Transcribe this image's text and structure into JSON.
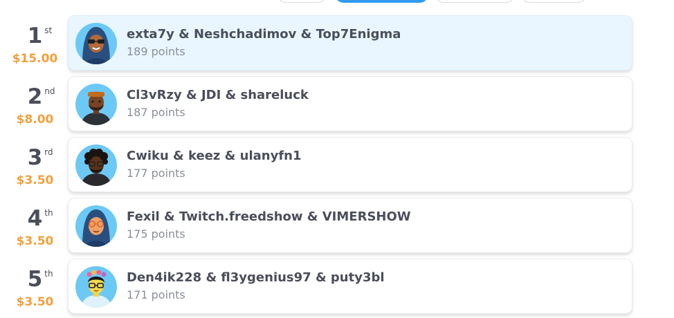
{
  "leaderboard": {
    "entries": [
      {
        "rank": "1",
        "suffix": "st",
        "prize": "$15.00",
        "names": "exta7y & Neshchadimov & Top7Enigma",
        "points": "189 points",
        "avatar": "hijab-sunglasses-avatar"
      },
      {
        "rank": "2",
        "suffix": "nd",
        "prize": "$8.00",
        "names": "Cl3vRzy & JDI & shareluck",
        "points": "187 points",
        "avatar": "bearded-man-avatar"
      },
      {
        "rank": "3",
        "suffix": "rd",
        "prize": "$3.50",
        "names": "Cwiku & keez & ulanyfn1",
        "points": "177 points",
        "avatar": "curly-hair-glasses-avatar"
      },
      {
        "rank": "4",
        "suffix": "th",
        "prize": "$3.50",
        "names": "Fexil & Twitch.freedshow & VIMERSHOW",
        "points": "175 points",
        "avatar": "hijab-glasses-avatar"
      },
      {
        "rank": "5",
        "suffix": "th",
        "prize": "$3.50",
        "names": "Den4ik228 & fl3ygenius97 & puty3bl",
        "points": "171 points",
        "avatar": "flower-crown-avatar"
      }
    ]
  },
  "colors": {
    "accent": "#2f9bf3",
    "prize": "#f2a03d",
    "highlight": "#e9f6ff",
    "text": "#4a4e5a",
    "muted": "#8a8f98"
  }
}
